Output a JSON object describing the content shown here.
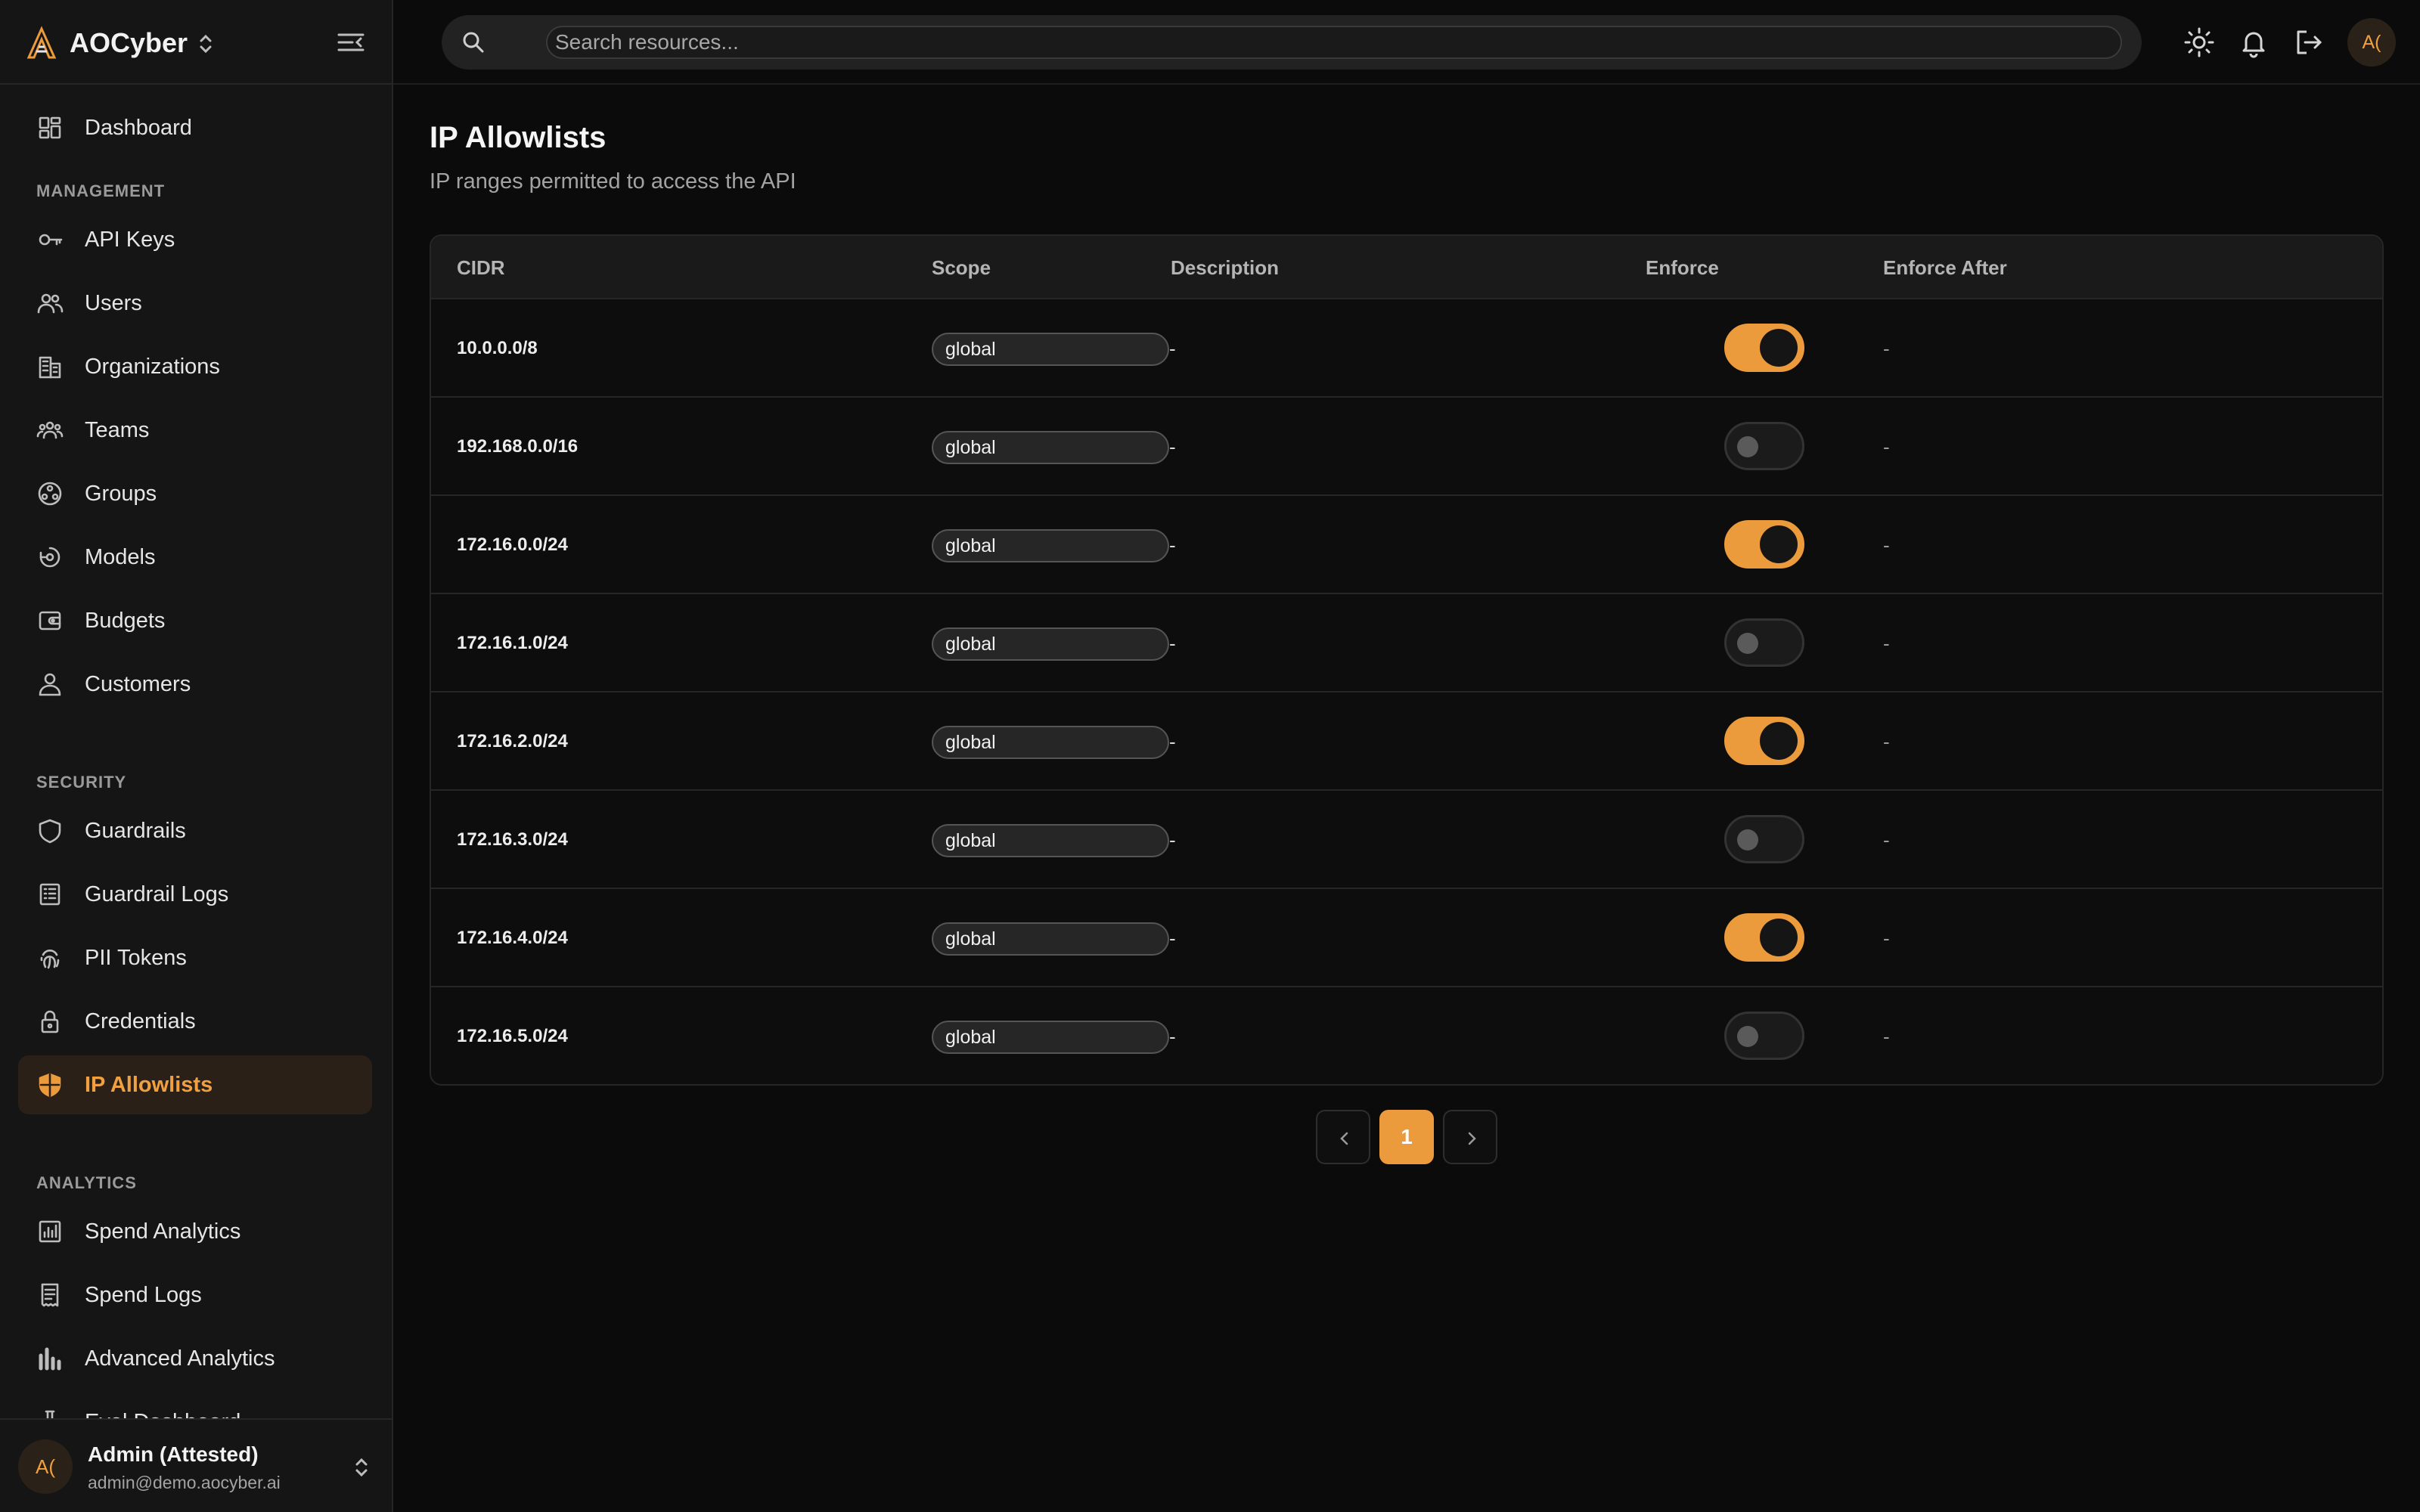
{
  "brand": {
    "name": "AOCyber"
  },
  "search": {
    "placeholder": "Search resources..."
  },
  "user": {
    "initials": "A(",
    "name": "Admin (Attested)",
    "email": "admin@demo.aocyber.ai"
  },
  "sidebar": {
    "dashboard": {
      "label": "Dashboard",
      "icon": "dashboard-icon"
    },
    "sections": [
      {
        "title": "MANAGEMENT",
        "items": [
          {
            "label": "API Keys",
            "icon": "key-icon"
          },
          {
            "label": "Users",
            "icon": "users-icon"
          },
          {
            "label": "Organizations",
            "icon": "building-icon"
          },
          {
            "label": "Teams",
            "icon": "team-icon"
          },
          {
            "label": "Groups",
            "icon": "groups-icon"
          },
          {
            "label": "Models",
            "icon": "model-icon"
          },
          {
            "label": "Budgets",
            "icon": "wallet-icon"
          },
          {
            "label": "Customers",
            "icon": "person-icon"
          }
        ]
      },
      {
        "title": "SECURITY",
        "items": [
          {
            "label": "Guardrails",
            "icon": "shield-icon"
          },
          {
            "label": "Guardrail Logs",
            "icon": "log-icon"
          },
          {
            "label": "PII Tokens",
            "icon": "fingerprint-icon"
          },
          {
            "label": "Credentials",
            "icon": "lock-icon"
          },
          {
            "label": "IP Allowlists",
            "icon": "shield-half-icon",
            "active": true
          }
        ]
      },
      {
        "title": "ANALYTICS",
        "items": [
          {
            "label": "Spend Analytics",
            "icon": "analytics-icon"
          },
          {
            "label": "Spend Logs",
            "icon": "receipt-icon"
          },
          {
            "label": "Advanced Analytics",
            "icon": "bar-chart-icon"
          },
          {
            "label": "Eval Dashboard",
            "icon": "flask-icon"
          }
        ]
      }
    ]
  },
  "page": {
    "title": "IP Allowlists",
    "subtitle": "IP ranges permitted to access the API"
  },
  "table": {
    "columns": {
      "cidr": "CIDR",
      "scope": "Scope",
      "description": "Description",
      "enforce": "Enforce",
      "enforce_after": "Enforce After"
    },
    "rows": [
      {
        "cidr": "10.0.0.0/8",
        "scope": "global",
        "description": "-",
        "enforce": true,
        "enforce_after": "-"
      },
      {
        "cidr": "192.168.0.0/16",
        "scope": "global",
        "description": "-",
        "enforce": false,
        "enforce_after": "-"
      },
      {
        "cidr": "172.16.0.0/24",
        "scope": "global",
        "description": "-",
        "enforce": true,
        "enforce_after": "-"
      },
      {
        "cidr": "172.16.1.0/24",
        "scope": "global",
        "description": "-",
        "enforce": false,
        "enforce_after": "-"
      },
      {
        "cidr": "172.16.2.0/24",
        "scope": "global",
        "description": "-",
        "enforce": true,
        "enforce_after": "-"
      },
      {
        "cidr": "172.16.3.0/24",
        "scope": "global",
        "description": "-",
        "enforce": false,
        "enforce_after": "-"
      },
      {
        "cidr": "172.16.4.0/24",
        "scope": "global",
        "description": "-",
        "enforce": true,
        "enforce_after": "-"
      },
      {
        "cidr": "172.16.5.0/24",
        "scope": "global",
        "description": "-",
        "enforce": false,
        "enforce_after": "-"
      }
    ]
  },
  "pagination": {
    "current": "1"
  },
  "colors": {
    "accent": "#eb9a3c",
    "background": "#0b0b0b",
    "sidebar": "#151515",
    "active_bg": "#2a2017"
  }
}
